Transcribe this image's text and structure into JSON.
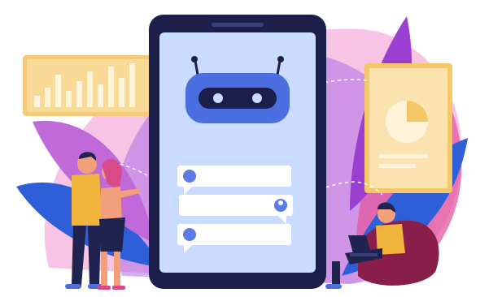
{
  "illustration": {
    "subject": "chatbot-messenger",
    "palette": {
      "blob_pink": "#f3a6d8",
      "blob_purple": "#7b3fc9",
      "leaf_blue": "#2f5fd8",
      "leaf_light": "#a9c1ff",
      "tablet_frame": "#1c1f4a",
      "screen": "#c9dbff",
      "robot": "#4b6fe0",
      "bar_chart_panel": "#f3c97a",
      "pie_panel": "#f6d08b",
      "bubble": "#ffffff",
      "icon_blue": "#5a7be8",
      "person_yellow": "#f0b43c",
      "person_dark": "#1e2350",
      "skin": "#f2a07b",
      "beanbag": "#8a1e4a"
    },
    "icons": [
      "robot-icon",
      "chat-bubble-icon",
      "user-icon",
      "bar-chart-icon",
      "pie-chart-icon",
      "laptop-icon"
    ]
  }
}
